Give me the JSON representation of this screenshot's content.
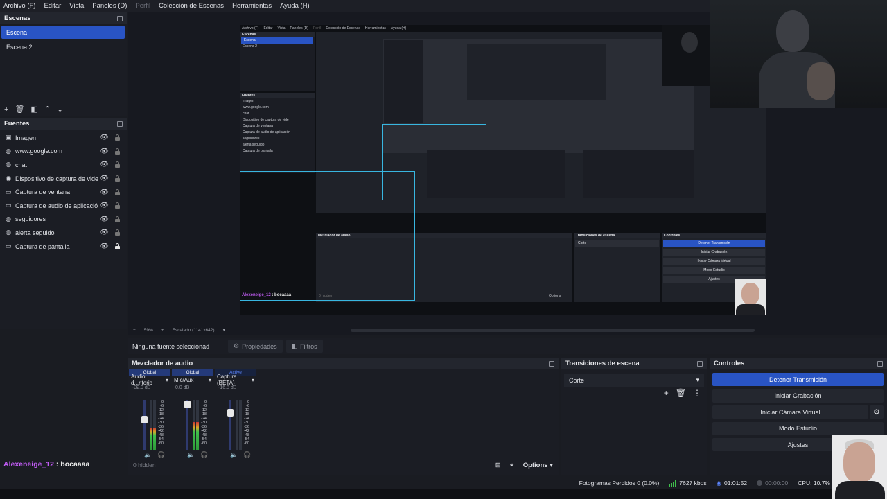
{
  "menu": [
    "Archivo (F)",
    "Editar",
    "Vista",
    "Paneles (D)",
    "Perfil",
    "Colección de Escenas",
    "Herramientas",
    "Ayuda (H)"
  ],
  "scenes": {
    "title": "Escenas",
    "items": [
      "Escena",
      "Escena 2"
    ],
    "selected": "Escena"
  },
  "sources": {
    "title": "Fuentes",
    "items": [
      {
        "name": "Imagen",
        "icon": "image-icon"
      },
      {
        "name": "www.google.com",
        "icon": "globe-icon"
      },
      {
        "name": "chat",
        "icon": "globe-icon"
      },
      {
        "name": "Dispositivo de captura de vide",
        "icon": "camera-icon"
      },
      {
        "name": "Captura de ventana",
        "icon": "window-icon"
      },
      {
        "name": "Captura de audio de aplicación",
        "icon": "window-icon"
      },
      {
        "name": "seguidores",
        "icon": "globe-icon"
      },
      {
        "name": "alerta seguido",
        "icon": "globe-icon"
      },
      {
        "name": "Captura de pantalla",
        "icon": "monitor-icon"
      }
    ]
  },
  "preview": {
    "zoom": "59%",
    "scale": "Escalado (1141x642)",
    "chat_user": "Alexeneige_12",
    "chat_message": ": bocaaaa",
    "nested_hidden": "0 hidden",
    "nested_options": "Options"
  },
  "context": {
    "label": "Ninguna fuente seleccionad",
    "properties": "Propiedades",
    "filters": "Filtros"
  },
  "mixer": {
    "title": "Mezclador de audio",
    "channels": [
      {
        "tag": "Global",
        "name": "Audio d...ritorio",
        "db": "-32.0 dB",
        "level": 0.45,
        "fader": 0.62
      },
      {
        "tag": "Global",
        "name": "Mic/Aux",
        "db": "0.0 dB",
        "level": 0.55,
        "fader": 0.98
      },
      {
        "tag": "Active",
        "name": "Captura... (BETA)",
        "db": "-16.8 dB",
        "level": 0.0,
        "fader": 0.78
      }
    ],
    "scale": [
      "0",
      "-6",
      "-12",
      "-18",
      "-24",
      "-30",
      "-36",
      "-42",
      "-48",
      "-54",
      "-60"
    ],
    "hidden": "0 hidden",
    "options": "Options"
  },
  "transitions": {
    "title": "Transiciones de escena",
    "selected": "Corte"
  },
  "controls": {
    "title": "Controles",
    "buttons": [
      "Detener Transmisión",
      "Iniciar Grabación",
      "Iniciar Cámara Virtual",
      "Modo Estudio",
      "Ajustes"
    ]
  },
  "status": {
    "dropped": "Fotogramas Perdidos 0 (0.0%)",
    "bitrate": "7627 kbps",
    "live_time": "01:01:52",
    "rec_time": "00:00:00",
    "cpu": "CPU: 10.7%"
  },
  "colors": {
    "accent": "#2954c4",
    "chat_user": "#c25cf5",
    "selection": "#38b6e0"
  }
}
